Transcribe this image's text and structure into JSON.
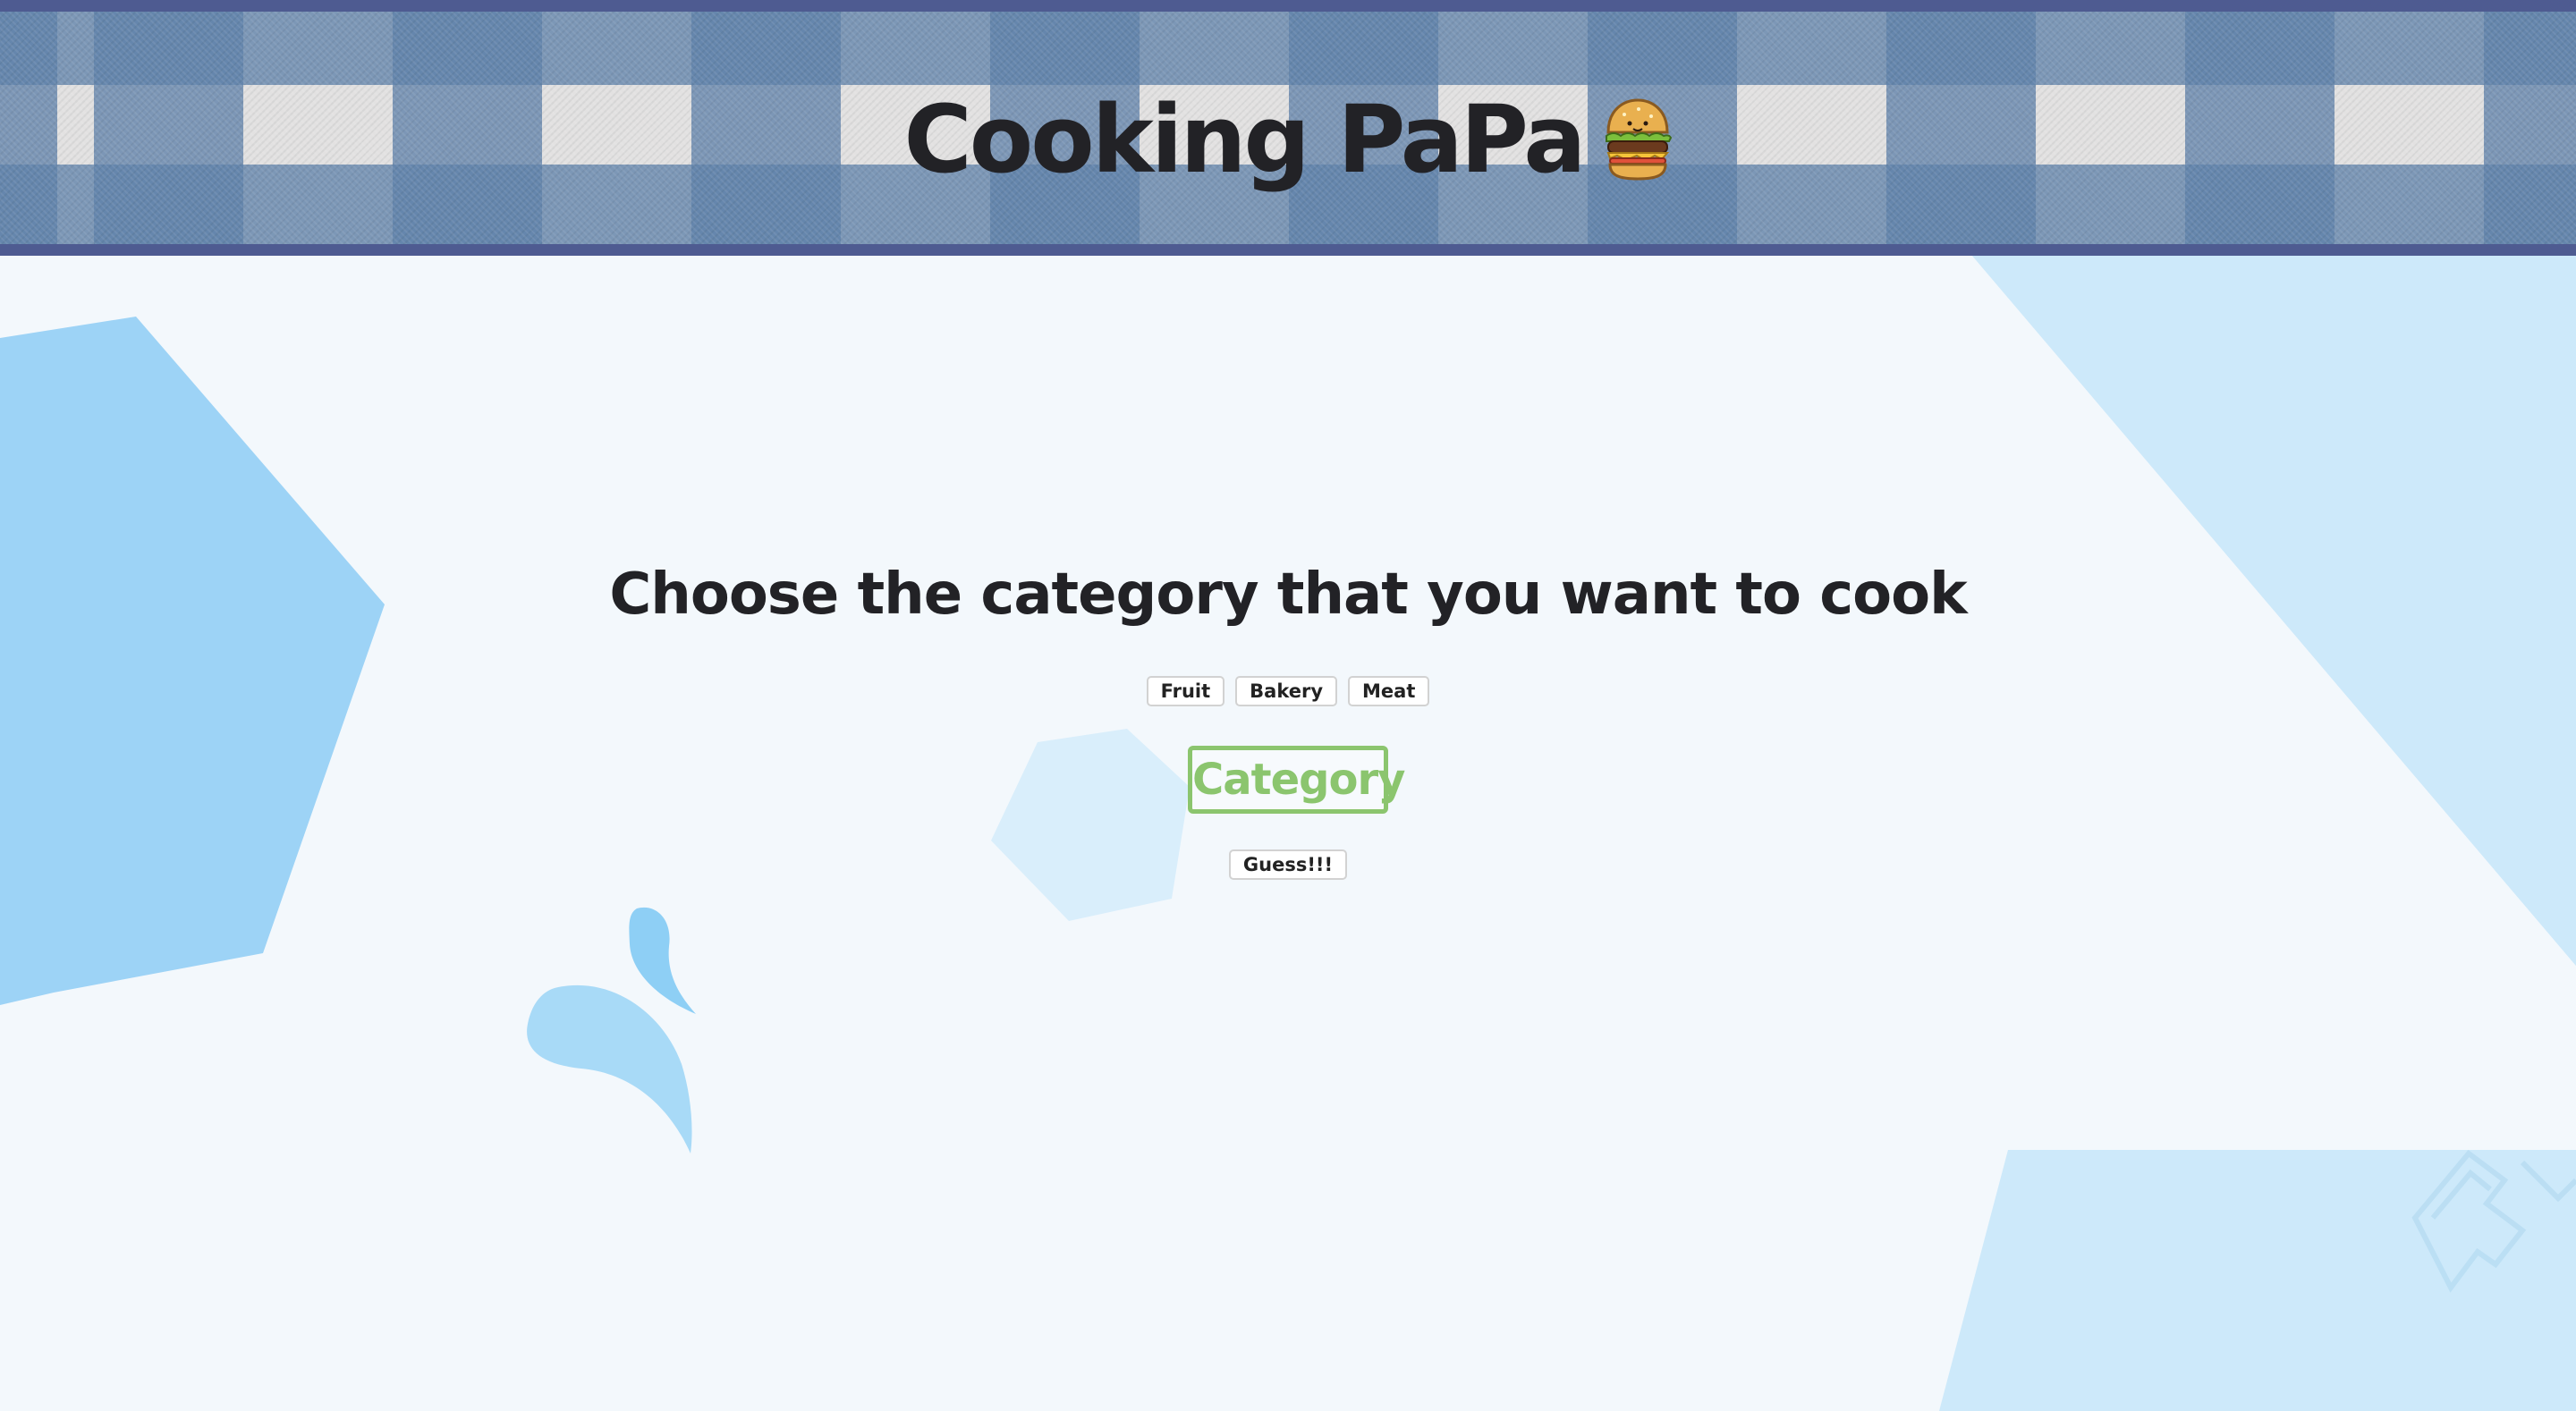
{
  "header": {
    "title": "Cooking PaPa",
    "icon": "burger-icon"
  },
  "main": {
    "heading": "Choose the category that you want to cook",
    "category_buttons": [
      {
        "label": "Fruit"
      },
      {
        "label": "Bakery"
      },
      {
        "label": "Meat"
      }
    ],
    "selected_category": "Category",
    "guess_button": "Guess!!!"
  },
  "colors": {
    "header_border": "#4e5b91",
    "title_text": "#222226",
    "category_accent": "#8bc56e",
    "background": "#f3f8fc",
    "shape_blue": "#9dd3f6",
    "shape_light_blue": "#cde9fa"
  }
}
